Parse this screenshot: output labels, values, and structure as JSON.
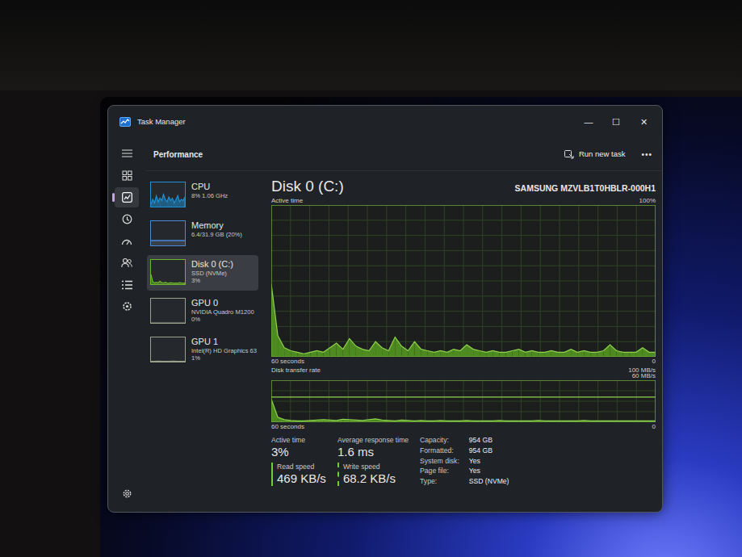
{
  "window": {
    "title": "Task Manager",
    "controls": [
      "—",
      "☐",
      "✕"
    ]
  },
  "nav": [
    {
      "selected": false
    },
    {
      "selected": true
    },
    {
      "selected": false
    },
    {
      "selected": false
    },
    {
      "selected": false
    },
    {
      "selected": false
    },
    {
      "selected": false
    }
  ],
  "header": {
    "title": "Performance",
    "run_task": "Run new task",
    "more": "•••"
  },
  "devices": [
    {
      "name": "CPU",
      "lines": [
        "8% 1.06 GHz"
      ],
      "selected": false,
      "kind": "line",
      "color": "#1e90d6",
      "values": [
        10,
        30,
        15,
        45,
        20,
        35,
        25,
        50,
        30,
        20,
        40,
        25,
        35,
        15,
        30,
        45,
        20,
        30,
        25,
        40
      ]
    },
    {
      "name": "Memory",
      "lines": [
        "6.4/31.9 GB (20%)"
      ],
      "selected": false,
      "kind": "bar",
      "color": "#4a8ad8",
      "level": 0.2
    },
    {
      "name": "Disk 0 (C:)",
      "lines": [
        "SSD (NVMe)",
        "3%"
      ],
      "selected": true,
      "kind": "line",
      "color": "#6cb52d",
      "values": [
        40,
        10,
        5,
        8,
        5,
        12,
        6,
        5,
        8,
        5,
        4,
        6,
        5,
        4,
        5,
        4,
        6,
        5,
        4,
        5
      ]
    },
    {
      "name": "GPU 0",
      "lines": [
        "NVIDIA Quadro M1200",
        "0%"
      ],
      "selected": false,
      "kind": "line",
      "color": "#9aa08a",
      "values": [
        0,
        0,
        0,
        0,
        0,
        0,
        0,
        0,
        0,
        0
      ]
    },
    {
      "name": "GPU 1",
      "lines": [
        "Intel(R) HD Graphics 63",
        "1%"
      ],
      "selected": false,
      "kind": "line",
      "color": "#9aa08a",
      "values": [
        1,
        1,
        2,
        1,
        1,
        1,
        2,
        1,
        1,
        1
      ]
    }
  ],
  "detail": {
    "title": "Disk 0 (C:)",
    "model": "SAMSUNG MZVLB1T0HBLR-000H1",
    "active_chart": {
      "label": "Active time",
      "max": "100%",
      "span": "60 seconds",
      "min": "0",
      "values": [
        48,
        14,
        6,
        4,
        3,
        2,
        3,
        4,
        3,
        6,
        9,
        5,
        12,
        7,
        5,
        4,
        10,
        6,
        4,
        13,
        7,
        4,
        10,
        5,
        4,
        3,
        4,
        3,
        5,
        4,
        8,
        5,
        4,
        3,
        4,
        3,
        3,
        4,
        5,
        3,
        4,
        3,
        3,
        4,
        3,
        3,
        5,
        3,
        4,
        3,
        3,
        4,
        8,
        4,
        3,
        3,
        3,
        6,
        3,
        3
      ]
    },
    "transfer_chart": {
      "label": "Disk transfer rate",
      "max": "100 MB/s",
      "marker": "60 MB/s",
      "marker_value": 60,
      "span": "60 seconds",
      "min": "0",
      "values": [
        55,
        12,
        6,
        4,
        3,
        3,
        4,
        5,
        6,
        5,
        4,
        7,
        6,
        5,
        4,
        6,
        8,
        5,
        4,
        3,
        5,
        4,
        3,
        4,
        3,
        3,
        4,
        3,
        3,
        3,
        4,
        3,
        3,
        3,
        3,
        4,
        3,
        3,
        3,
        3,
        3,
        4,
        3,
        3,
        3,
        3,
        3,
        3,
        4,
        3,
        3,
        3,
        3,
        3,
        3,
        3,
        3,
        3,
        3,
        3
      ]
    },
    "stats": [
      {
        "label": "Active time",
        "value": "3%"
      },
      {
        "label": "Average response time",
        "value": "1.6 ms"
      }
    ],
    "speeds": [
      {
        "label": "Read speed",
        "value": "469 KB/s"
      },
      {
        "label": "Write speed",
        "value": "68.2 KB/s"
      }
    ],
    "properties": [
      {
        "label": "Capacity:",
        "value": "954 GB"
      },
      {
        "label": "Formatted:",
        "value": "954 GB"
      },
      {
        "label": "System disk:",
        "value": "Yes"
      },
      {
        "label": "Page file:",
        "value": "Yes"
      },
      {
        "label": "Type:",
        "value": "SSD (NVMe)"
      }
    ]
  }
}
